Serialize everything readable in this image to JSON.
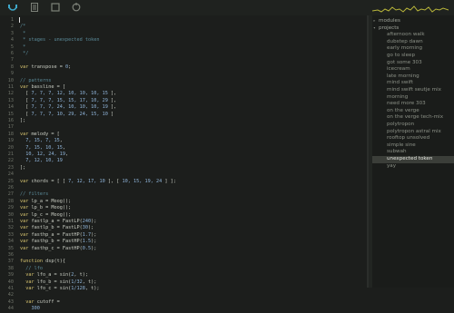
{
  "toolbar": {
    "icons": [
      "listen-icon",
      "document-icon",
      "stop-icon",
      "reset-icon"
    ],
    "accent": "#3fa8c9"
  },
  "editor": {
    "lines": [
      {
        "n": "1",
        "segs": []
      },
      {
        "n": "2",
        "segs": [
          [
            "cm",
            "/*"
          ]
        ]
      },
      {
        "n": "3",
        "segs": [
          [
            "cm",
            " *"
          ]
        ]
      },
      {
        "n": "4",
        "segs": [
          [
            "cm",
            " * stages - unexpected token"
          ]
        ]
      },
      {
        "n": "5",
        "segs": [
          [
            "cm",
            " *"
          ]
        ]
      },
      {
        "n": "6",
        "segs": [
          [
            "cm",
            " */"
          ]
        ]
      },
      {
        "n": "7",
        "segs": []
      },
      {
        "n": "8",
        "segs": [
          [
            "kw",
            "var"
          ],
          [
            "",
            " transpose = "
          ],
          [
            "num",
            "0"
          ],
          [
            "",
            ";"
          ]
        ]
      },
      {
        "n": "9",
        "segs": []
      },
      {
        "n": "10",
        "segs": [
          [
            "cm",
            "// patterns"
          ]
        ]
      },
      {
        "n": "11",
        "segs": [
          [
            "kw",
            "var"
          ],
          [
            "",
            " bassline = ["
          ]
        ]
      },
      {
        "n": "12",
        "segs": [
          [
            "",
            "  [ "
          ],
          [
            "num",
            "7, 7, 7, 12, 10, 10, 10, 15"
          ],
          [
            "",
            " ],"
          ]
        ]
      },
      {
        "n": "13",
        "segs": [
          [
            "",
            "  [ "
          ],
          [
            "num",
            "7, 7, 7, 15, 15, 17, 10, 29"
          ],
          [
            "",
            " ],"
          ]
        ]
      },
      {
        "n": "14",
        "segs": [
          [
            "",
            "  [ "
          ],
          [
            "num",
            "7, 7, 7, 24, 10, 10, 10, 19"
          ],
          [
            "",
            " ],"
          ]
        ]
      },
      {
        "n": "15",
        "segs": [
          [
            "",
            "  [ "
          ],
          [
            "num",
            "7, 7, 7, 10, 29, 24, 15, 10"
          ],
          [
            "",
            " ]"
          ]
        ]
      },
      {
        "n": "16",
        "segs": [
          [
            "",
            "];"
          ]
        ]
      },
      {
        "n": "17",
        "segs": []
      },
      {
        "n": "18",
        "segs": [
          [
            "kw",
            "var"
          ],
          [
            "",
            " melody = ["
          ]
        ]
      },
      {
        "n": "19",
        "segs": [
          [
            "",
            "  "
          ],
          [
            "num",
            "7, 15, 7, 15"
          ],
          [
            "",
            ","
          ]
        ]
      },
      {
        "n": "20",
        "segs": [
          [
            "",
            "  "
          ],
          [
            "num",
            "7, 15, 10, 15"
          ],
          [
            "",
            ","
          ]
        ]
      },
      {
        "n": "21",
        "segs": [
          [
            "",
            "  "
          ],
          [
            "num",
            "10, 12, 24, 19"
          ],
          [
            "",
            ","
          ]
        ]
      },
      {
        "n": "22",
        "segs": [
          [
            "",
            "  "
          ],
          [
            "num",
            "7, 12, 10, 19"
          ]
        ]
      },
      {
        "n": "23",
        "segs": [
          [
            "",
            "];"
          ]
        ]
      },
      {
        "n": "24",
        "segs": []
      },
      {
        "n": "25",
        "segs": [
          [
            "kw",
            "var"
          ],
          [
            "",
            " chords = [ [ "
          ],
          [
            "num",
            "7, 12, 17, 10"
          ],
          [
            "",
            " ], [ "
          ],
          [
            "num",
            "10, 15, 19, 24"
          ],
          [
            "",
            " ] ];"
          ]
        ]
      },
      {
        "n": "26",
        "segs": []
      },
      {
        "n": "27",
        "segs": [
          [
            "cm",
            "// filters"
          ]
        ]
      },
      {
        "n": "28",
        "segs": [
          [
            "kw",
            "var"
          ],
          [
            "",
            " lp_a = Moog();"
          ]
        ]
      },
      {
        "n": "29",
        "segs": [
          [
            "kw",
            "var"
          ],
          [
            "",
            " lp_b = Moog();"
          ]
        ]
      },
      {
        "n": "30",
        "segs": [
          [
            "kw",
            "var"
          ],
          [
            "",
            " lp_c = Moog();"
          ]
        ]
      },
      {
        "n": "31",
        "segs": [
          [
            "kw",
            "var"
          ],
          [
            "",
            " fastlp_a = FastLP("
          ],
          [
            "num",
            "240"
          ],
          [
            "",
            ");"
          ]
        ]
      },
      {
        "n": "32",
        "segs": [
          [
            "kw",
            "var"
          ],
          [
            "",
            " fastlp_b = FastLP("
          ],
          [
            "num",
            "30"
          ],
          [
            "",
            ");"
          ]
        ]
      },
      {
        "n": "33",
        "segs": [
          [
            "kw",
            "var"
          ],
          [
            "",
            " fasthp_a = FastHP("
          ],
          [
            "num",
            "1.7"
          ],
          [
            "",
            ");"
          ]
        ]
      },
      {
        "n": "34",
        "segs": [
          [
            "kw",
            "var"
          ],
          [
            "",
            " fasthp_b = FastHP("
          ],
          [
            "num",
            "1.5"
          ],
          [
            "",
            ");"
          ]
        ]
      },
      {
        "n": "35",
        "segs": [
          [
            "kw",
            "var"
          ],
          [
            "",
            " fasthp_c = FastHP("
          ],
          [
            "num",
            "0.5"
          ],
          [
            "",
            ");"
          ]
        ]
      },
      {
        "n": "36",
        "segs": []
      },
      {
        "n": "37",
        "segs": [
          [
            "kw",
            "function"
          ],
          [
            "",
            " dsp(t){"
          ]
        ]
      },
      {
        "n": "38",
        "segs": [
          [
            "cm",
            "  // lfo"
          ]
        ]
      },
      {
        "n": "39",
        "segs": [
          [
            "",
            "  "
          ],
          [
            "kw",
            "var"
          ],
          [
            "",
            " lfo_a = sin("
          ],
          [
            "num",
            "2"
          ],
          [
            "",
            ", t);"
          ]
        ]
      },
      {
        "n": "40",
        "segs": [
          [
            "",
            "  "
          ],
          [
            "kw",
            "var"
          ],
          [
            "",
            " lfo_b = sin("
          ],
          [
            "num",
            "1/32"
          ],
          [
            "",
            ", t);"
          ]
        ]
      },
      {
        "n": "41",
        "segs": [
          [
            "",
            "  "
          ],
          [
            "kw",
            "var"
          ],
          [
            "",
            " lfo_c = sin("
          ],
          [
            "num",
            "1/128"
          ],
          [
            "",
            ", t);"
          ]
        ]
      },
      {
        "n": "42",
        "segs": []
      },
      {
        "n": "43",
        "segs": [
          [
            "",
            "  "
          ],
          [
            "kw",
            "var"
          ],
          [
            "",
            " cutoff ="
          ]
        ]
      },
      {
        "n": "44",
        "segs": [
          [
            "",
            "    "
          ],
          [
            "num",
            "300"
          ]
        ]
      }
    ]
  },
  "sidebar": {
    "folders": [
      {
        "label": "modules",
        "open": false,
        "arrow": "▸"
      },
      {
        "label": "projects",
        "open": true,
        "arrow": "▾"
      }
    ],
    "items": [
      {
        "label": "afternoon walk",
        "selected": false
      },
      {
        "label": "dubstep dawn",
        "selected": false
      },
      {
        "label": "early morning",
        "selected": false
      },
      {
        "label": "go to sleep",
        "selected": false
      },
      {
        "label": "got some 303",
        "selected": false
      },
      {
        "label": "icecream",
        "selected": false
      },
      {
        "label": "late morning",
        "selected": false
      },
      {
        "label": "mind swift",
        "selected": false
      },
      {
        "label": "mind swift seutje mix",
        "selected": false
      },
      {
        "label": "morning",
        "selected": false
      },
      {
        "label": "need more 303",
        "selected": false
      },
      {
        "label": "on the verge",
        "selected": false
      },
      {
        "label": "on the verge tech-mix",
        "selected": false
      },
      {
        "label": "polytropon",
        "selected": false
      },
      {
        "label": "polytropon astral mix",
        "selected": false
      },
      {
        "label": "rooftop unsolved",
        "selected": false
      },
      {
        "label": "simple sine",
        "selected": false
      },
      {
        "label": "subwah",
        "selected": false
      },
      {
        "label": "unexpected token",
        "selected": true
      },
      {
        "label": "yay",
        "selected": false
      }
    ]
  }
}
